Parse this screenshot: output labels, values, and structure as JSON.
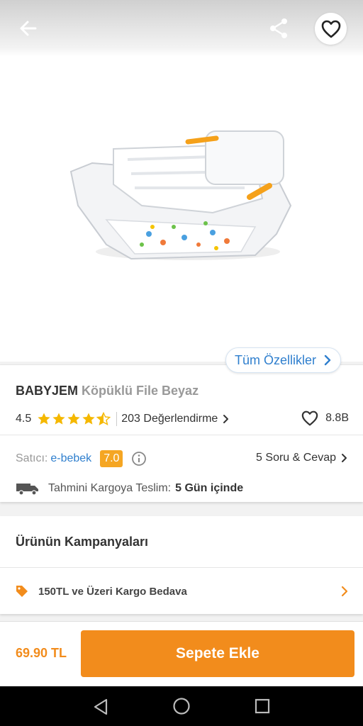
{
  "header": {
    "back_icon": "arrow-left-icon",
    "share_icon": "share-icon",
    "favorite_icon": "heart-outline-icon"
  },
  "product": {
    "image_alt": "bath-tub-product-image",
    "all_features_label": "Tüm Özellikler",
    "brand": "BABYJEM",
    "name": "Köpüklü File Beyaz",
    "rating": "4.5",
    "rating_value": 4.5,
    "reviews_label": "203 Değerlendirme",
    "favorites_count": "8.8B"
  },
  "seller": {
    "label": "Satıcı:",
    "name": "e-bebek",
    "score": "7.0",
    "qa_label": "5 Soru & Cevap"
  },
  "shipping": {
    "label": "Tahmini Kargoya Teslim:",
    "value": "5 Gün içinde"
  },
  "campaigns": {
    "title": "Ürünün Kampanyaları",
    "items": [
      {
        "label": "150TL ve Üzeri Kargo Bedava"
      }
    ]
  },
  "cart": {
    "price": "69.90 TL",
    "add_button": "Sepete Ekle"
  },
  "colors": {
    "accent_orange": "#f28c1c",
    "link_blue": "#2f7fce",
    "star_yellow": "#f5b800",
    "score_badge": "#f5a623"
  }
}
